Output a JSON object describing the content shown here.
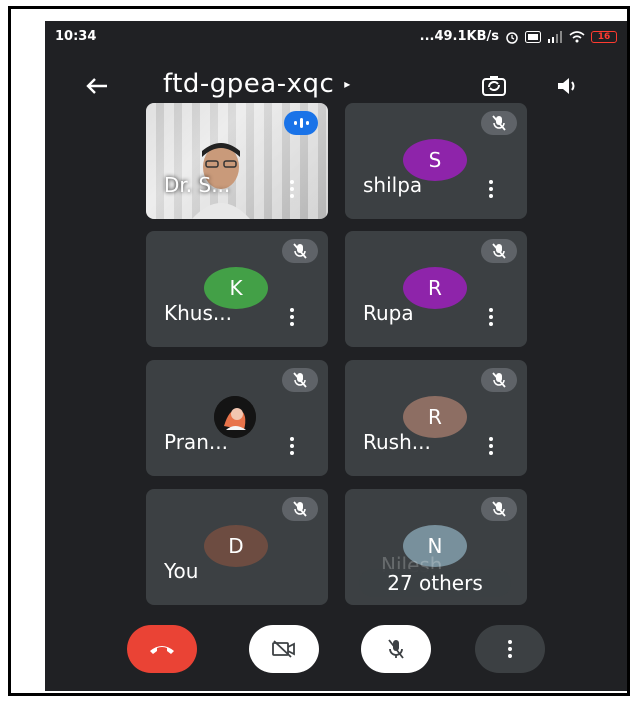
{
  "status": {
    "time": "10:34",
    "network": "...49.1KB/s",
    "battery": "16"
  },
  "meeting": {
    "code": "ftd-gpea-xqc",
    "back_icon": "arrow-left-icon",
    "switch_camera_icon": "switch-camera-icon",
    "speaker_icon": "speaker-icon"
  },
  "participants": [
    {
      "name": "Dr. S...",
      "type": "video",
      "speaking": true
    },
    {
      "name": "shilpa",
      "initial": "S",
      "color": "#8e24aa",
      "muted": true
    },
    {
      "name": "Khus...",
      "initial": "K",
      "color": "#43a047",
      "muted": true
    },
    {
      "name": "Rupa",
      "initial": "R",
      "color": "#8e24aa",
      "muted": true
    },
    {
      "name": "Pran...",
      "type": "photo",
      "muted": true
    },
    {
      "name": "Rush...",
      "initial": "R",
      "color": "#8d6e63",
      "muted": true
    },
    {
      "name": "You",
      "initial": "D",
      "color": "#6d4c41",
      "muted": true
    },
    {
      "initial": "N",
      "color": "#78909c",
      "muted": true,
      "ghost_name": "Nilesh",
      "others_label": "27 others"
    }
  ],
  "controls": {
    "end_call_icon": "end-call-icon",
    "camera_icon": "camera-off-icon",
    "mic_icon": "mic-off-icon",
    "more_icon": "more-vert-icon"
  }
}
